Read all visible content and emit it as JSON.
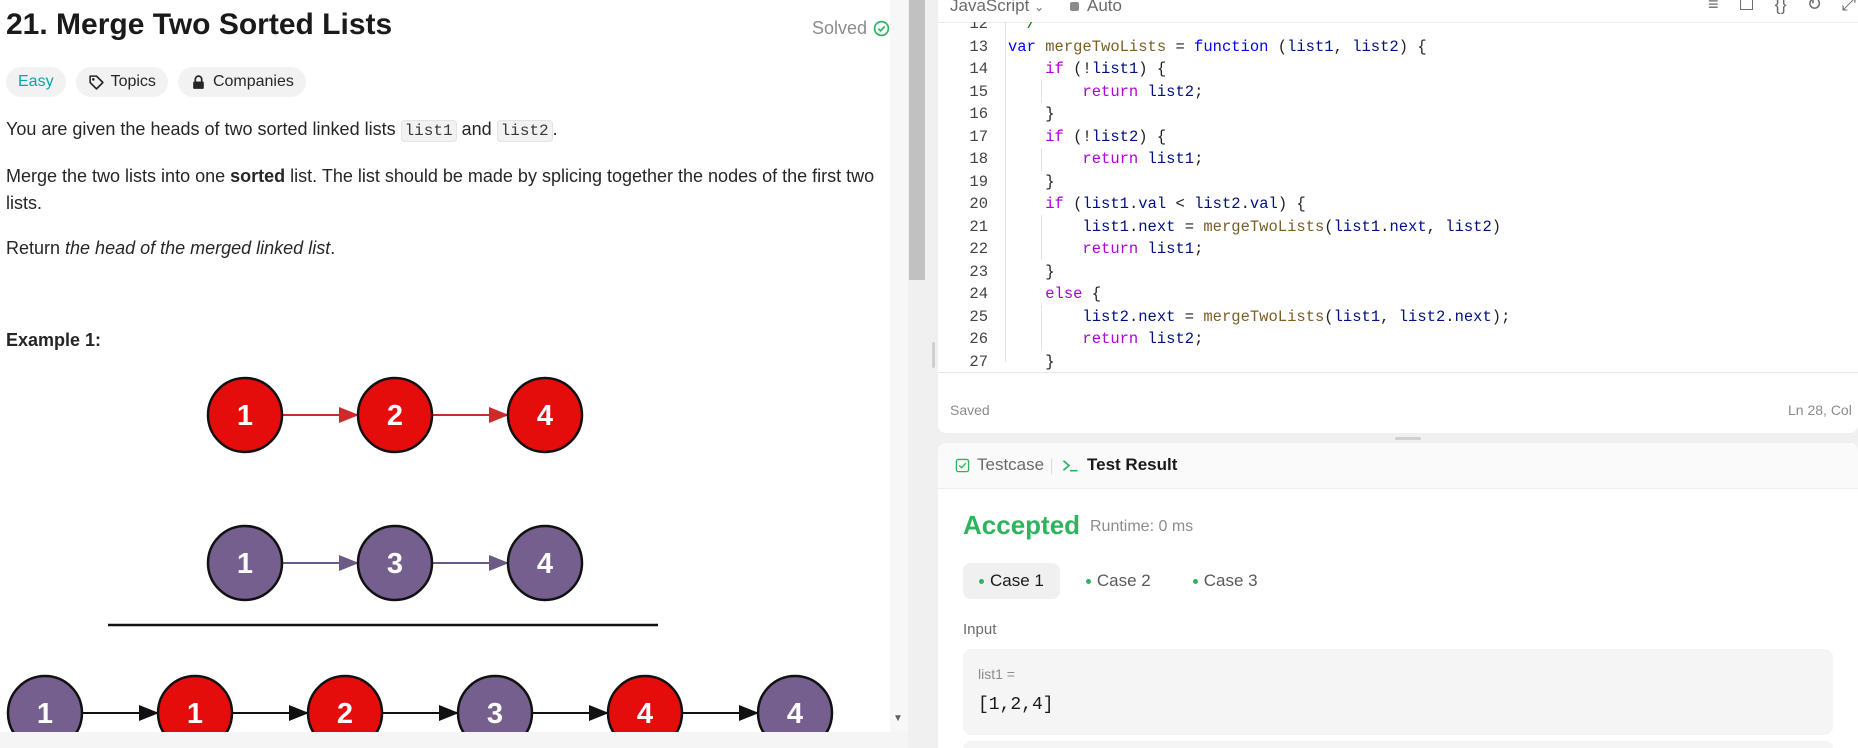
{
  "problem": {
    "title": "21. Merge Two Sorted Lists",
    "status": "Solved",
    "tags": {
      "difficulty": "Easy",
      "topics": "Topics",
      "companies": "Companies"
    },
    "p1_pre": "You are given the heads of two sorted linked lists ",
    "p1_code1": "list1",
    "p1_mid": " and ",
    "p1_code2": "list2",
    "p1_post": ".",
    "p2_pre": "Merge the two lists into one ",
    "p2_bold": "sorted",
    "p2_post": " list. The list should be made by splicing together the nodes of the first two lists.",
    "p3_pre": "Return ",
    "p3_em": "the head of the merged linked list",
    "p3_post": ".",
    "example_title": "Example 1:",
    "diagram": {
      "list1": [
        "1",
        "2",
        "4"
      ],
      "list2": [
        "1",
        "3",
        "4"
      ],
      "merged": [
        "1",
        "1",
        "2",
        "3",
        "4",
        "4"
      ],
      "colors": {
        "red": "#e50c0c",
        "purple": "#745f8f",
        "red_edge": "#cc2b2b",
        "purple_edge": "#6b5a86"
      }
    }
  },
  "editor": {
    "language": "JavaScript",
    "mode": "Auto",
    "saved": "Saved",
    "cursor": "Ln 28, Col"
  },
  "result": {
    "tab_testcase": "Testcase",
    "tab_result": "Test Result",
    "verdict": "Accepted",
    "runtime": "Runtime: 0 ms",
    "cases": [
      "Case 1",
      "Case 2",
      "Case 3"
    ],
    "input_label": "Input",
    "var_name": "list1 =",
    "var_value": "[1,2,4]"
  }
}
